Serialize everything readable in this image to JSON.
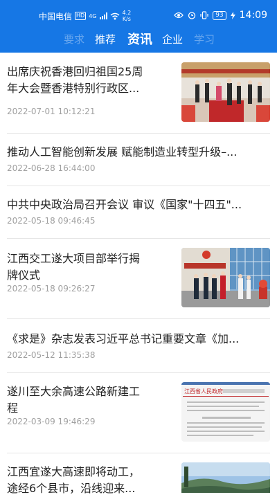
{
  "status_bar": {
    "carrier": "中国电信",
    "hd": "HD",
    "network": "4G",
    "speed_value": "4.2",
    "speed_unit": "K/s",
    "battery": "93",
    "time": "14:09"
  },
  "tabs": [
    {
      "label": "要求"
    },
    {
      "label": "推荐"
    },
    {
      "label": "资讯"
    },
    {
      "label": "企业"
    },
    {
      "label": "学习"
    }
  ],
  "news": [
    {
      "title_line1": "出席庆祝香港回归祖国25周",
      "title_line2": "年大会暨香港特别行政区...",
      "date": "2022-07-01 10:12:21",
      "thumb": "ceremony-photo"
    },
    {
      "title_line1": "推动人工智能创新发展 赋能制造业转型升级–...",
      "title_line2": "",
      "date": "2022-06-28 16:44:00",
      "thumb": ""
    },
    {
      "title_line1": "中共中央政治局召开会议 审议《国家\"十四五\"...",
      "title_line2": "",
      "date": "2022-05-18 09:46:45",
      "thumb": ""
    },
    {
      "title_line1": "江西交工遂大项目部举行揭",
      "title_line2": "牌仪式",
      "date": "2022-05-18 09:26:27",
      "thumb": "unveiling-photo"
    },
    {
      "title_line1": "《求是》杂志发表习近平总书记重要文章《加...",
      "title_line2": "",
      "date": "2022-05-12 11:35:38",
      "thumb": ""
    },
    {
      "title_line1": "遂川至大余高速公路新建工",
      "title_line2": "程",
      "date": "2022-03-09 19:46:29",
      "thumb": "document-photo"
    },
    {
      "title_line1": "江西宜遂大高速即将动工，",
      "title_line2": "途经6个县市，沿线迎来...",
      "date": "",
      "thumb": "landscape-photo"
    }
  ],
  "doc_header": "江西省人民政府",
  "colors": {
    "header": "#1677e5",
    "divider": "#e6e6e6",
    "date": "#a0a0a0"
  }
}
